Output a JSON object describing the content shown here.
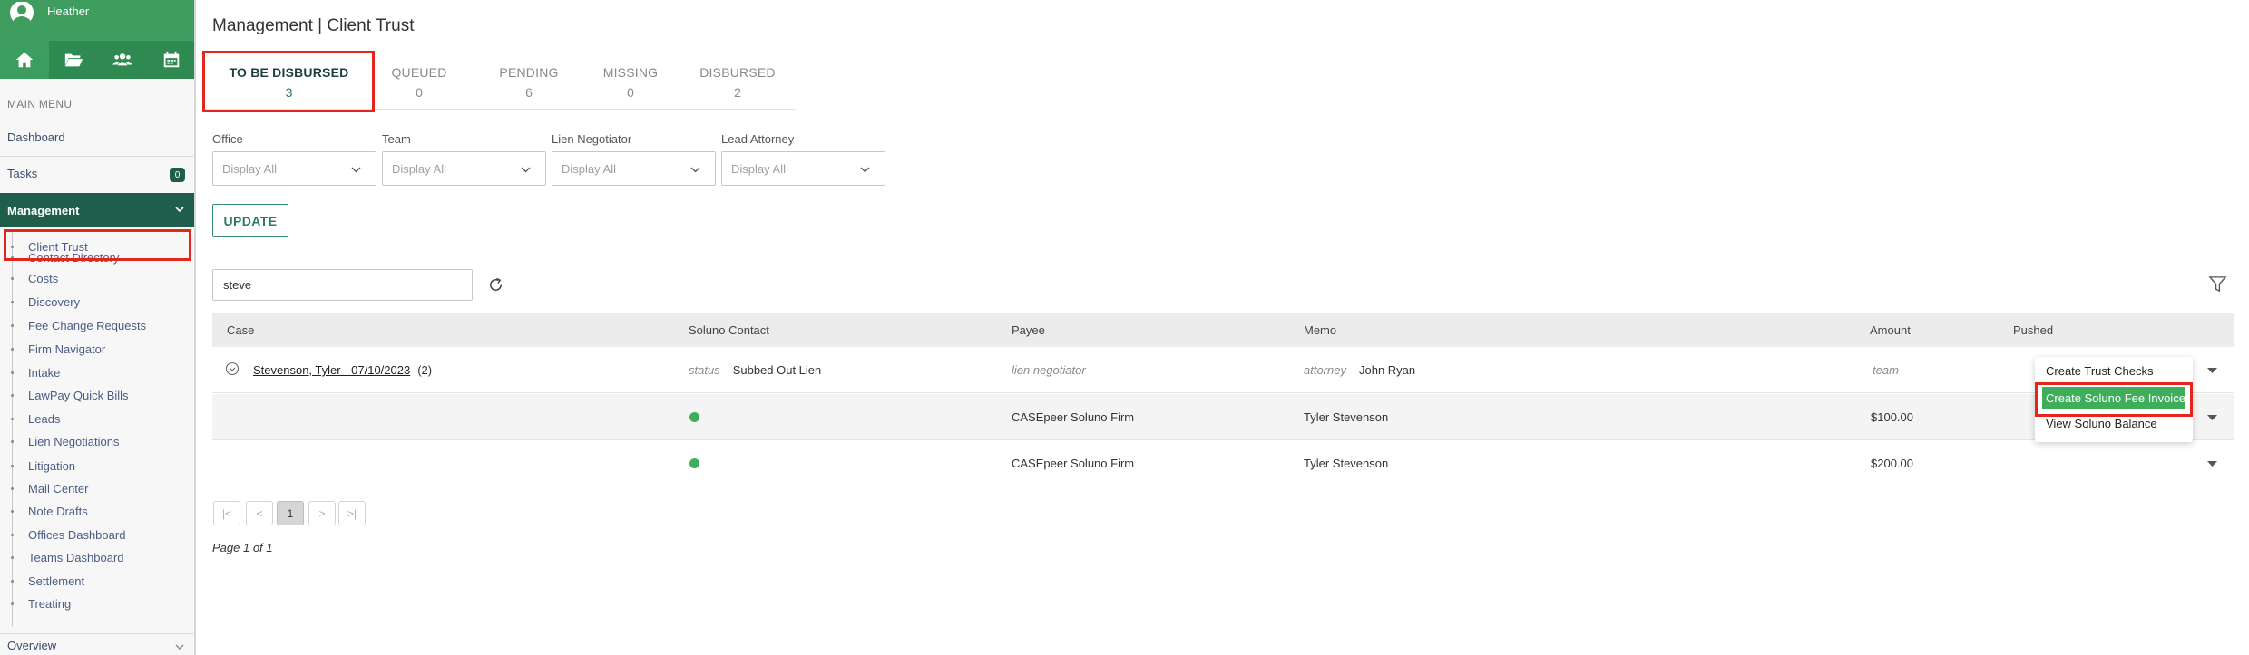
{
  "sidebar": {
    "username": "Heather",
    "main_menu_label": "MAIN MENU",
    "dashboard_label": "Dashboard",
    "tasks_label": "Tasks",
    "tasks_count": "0",
    "management_label": "Management",
    "submenu": [
      "Client Trust",
      "Contact Directory",
      "Costs",
      "Discovery",
      "Fee Change Requests",
      "Firm Navigator",
      "Intake",
      "LawPay Quick Bills",
      "Leads",
      "Lien Negotiations",
      "Litigation",
      "Mail Center",
      "Note Drafts",
      "Offices Dashboard",
      "Teams Dashboard",
      "Settlement",
      "Treating"
    ],
    "overview_label": "Overview",
    "icons": [
      "home-icon",
      "folder-open-icon",
      "users-icon",
      "calendar-icon"
    ]
  },
  "page": {
    "title": "Management | Client Trust"
  },
  "tabs": [
    {
      "label": "TO BE DISBURSED",
      "count": "3"
    },
    {
      "label": "QUEUED",
      "count": "0"
    },
    {
      "label": "PENDING",
      "count": "6"
    },
    {
      "label": "MISSING",
      "count": "0"
    },
    {
      "label": "DISBURSED",
      "count": "2"
    }
  ],
  "filters": [
    {
      "label": "Office",
      "value": "Display All"
    },
    {
      "label": "Team",
      "value": "Display All"
    },
    {
      "label": "Lien Negotiator",
      "value": "Display All"
    },
    {
      "label": "Lead Attorney",
      "value": "Display All"
    }
  ],
  "update_label": "UPDATE",
  "search": {
    "value": "steve"
  },
  "table": {
    "columns": [
      "Case",
      "Soluno Contact",
      "Payee",
      "Memo",
      "Amount",
      "Pushed"
    ],
    "group_row": {
      "case": "Stevenson, Tyler - 07/10/2023",
      "case_count": "(2)",
      "status_key": "status",
      "status_value": "Subbed Out Lien",
      "lien_key": "lien negotiator",
      "attorney_key": "attorney",
      "attorney_value": "John Ryan",
      "team_key": "team"
    },
    "rows": [
      {
        "payee": "CASEpeer Soluno Firm",
        "memo": "Tyler Stevenson",
        "amount": "$100.00"
      },
      {
        "payee": "CASEpeer Soluno Firm",
        "memo": "Tyler Stevenson",
        "amount": "$200.00"
      }
    ]
  },
  "action_menu": [
    "Create Trust Checks",
    "Create Soluno Fee Invoice",
    "View Soluno Balance"
  ],
  "pagination": {
    "first": "|<",
    "prev": "<",
    "current": "1",
    "next": ">",
    "last": ">|",
    "info": "Page 1 of 1"
  },
  "colors": {
    "sidebar_green": "#3f9e5f",
    "management_dark": "#1e5e4a",
    "highlight_red": "#e3261b",
    "menu_green": "#3fae5a"
  }
}
